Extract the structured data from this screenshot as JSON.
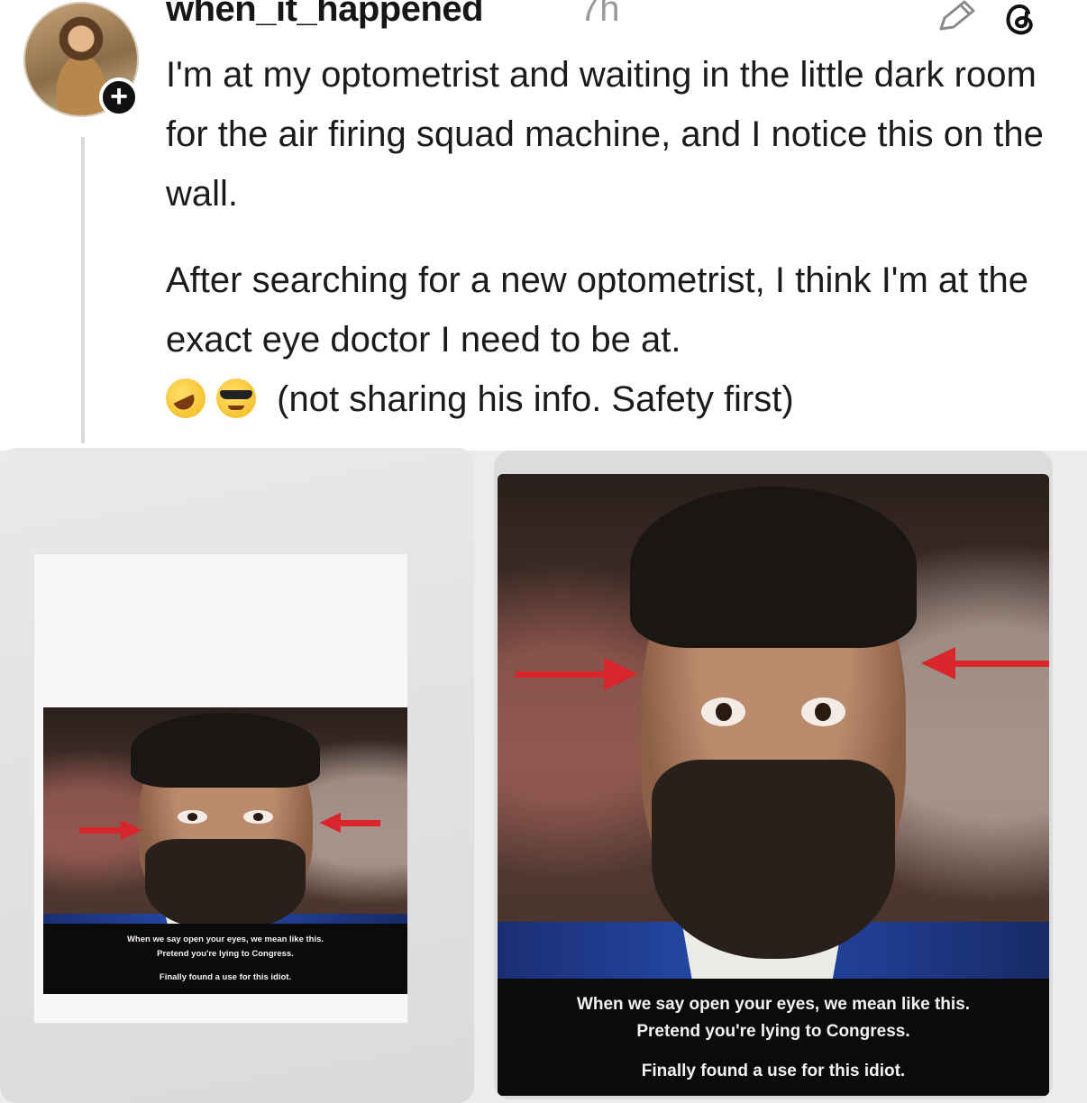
{
  "post": {
    "username": "when_it_happened",
    "time": "7h",
    "paragraph1": "I'm at my optometrist and waiting in the little dark room for the air firing squad machine, and I notice this on the wall.",
    "paragraph2_main": "After searching for a new optometrist, I think I'm at the exact eye doctor I need to be at.",
    "paragraph2_tail": "(not sharing his info. Safety first)",
    "emojis": [
      "rolling-on-floor-laughing-icon",
      "sunglasses-face-icon"
    ]
  },
  "images": {
    "caption_line1": "When we say open your eyes, we mean like this.",
    "caption_line2": "Pretend you're lying to Congress.",
    "caption_line3": "Finally found a use for this idiot."
  },
  "colors": {
    "arrow": "#d8262c",
    "caption_bg": "#0b0b0b",
    "suit": "#244aa8"
  }
}
